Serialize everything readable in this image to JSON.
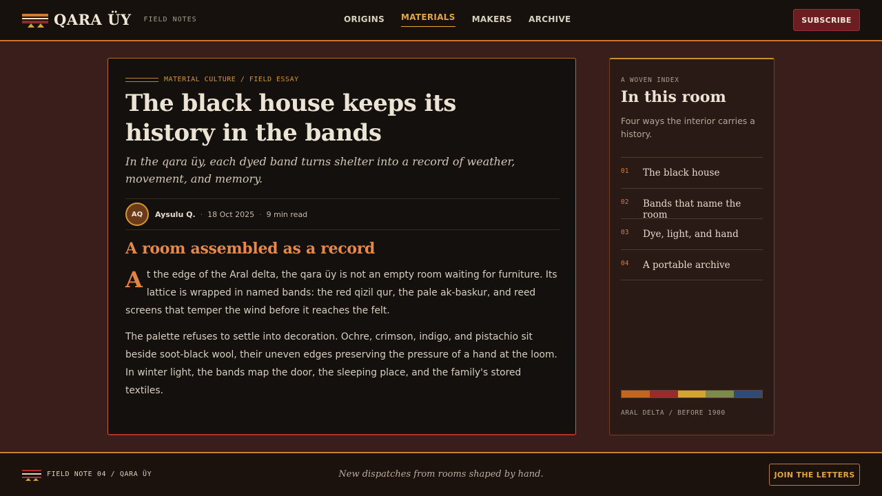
{
  "header": {
    "brand_name": "QARA ÜY",
    "brand_tag": "FIELD NOTES",
    "nav": [
      {
        "label": "ORIGINS",
        "active": false
      },
      {
        "label": "MATERIALS",
        "active": true
      },
      {
        "label": "MAKERS",
        "active": false
      },
      {
        "label": "ARCHIVE",
        "active": false
      }
    ],
    "subscribe_label": "SUBSCRIBE"
  },
  "article": {
    "kicker": "MATERIAL CULTURE / FIELD ESSAY",
    "headline": "The black house keeps its history in the bands",
    "dek": "In the qara üy, each dyed band turns shelter into a record of weather, movement, and memory.",
    "byline": {
      "initials": "AQ",
      "author": "Aysulu Q.",
      "date": "18 Oct 2025",
      "read_time": "9 min read"
    },
    "section_heading": "A room assembled as a record",
    "paragraph1_dropcap": "A",
    "paragraph1_rest": "t the edge of the Aral delta, the qara üy is not an empty room waiting for furniture. Its lattice is wrapped in named bands: the red qizil qur, the pale ak-baskur, and reed screens that temper the wind before it reaches the felt.",
    "paragraph2": "The palette refuses to settle into decoration. Ochre, crimson, indigo, and pistachio sit beside soot-black wool, their uneven edges preserving the pressure of a hand at the loom. In winter light, the bands map the door, the sleeping place, and the family's stored textiles."
  },
  "sidebar": {
    "kicker": "A WOVEN INDEX",
    "title": "In this room",
    "description": "Four ways the interior carries a history.",
    "toc": [
      {
        "num": "01",
        "label": "The black house"
      },
      {
        "num": "02",
        "label": "Bands that name the room"
      },
      {
        "num": "03",
        "label": "Dye, light, and hand"
      },
      {
        "num": "04",
        "label": "A portable archive"
      }
    ],
    "palette": [
      "#c1651f",
      "#9b2a2c",
      "#d4a330",
      "#7e8a4c",
      "#2e4a78"
    ],
    "footnote": "ARAL DELTA / BEFORE 1900"
  },
  "footer": {
    "note": "FIELD NOTE 04 / QARA ÜY",
    "tagline": "New dispatches from rooms shaped by hand.",
    "join_label": "JOIN THE LETTERS"
  }
}
